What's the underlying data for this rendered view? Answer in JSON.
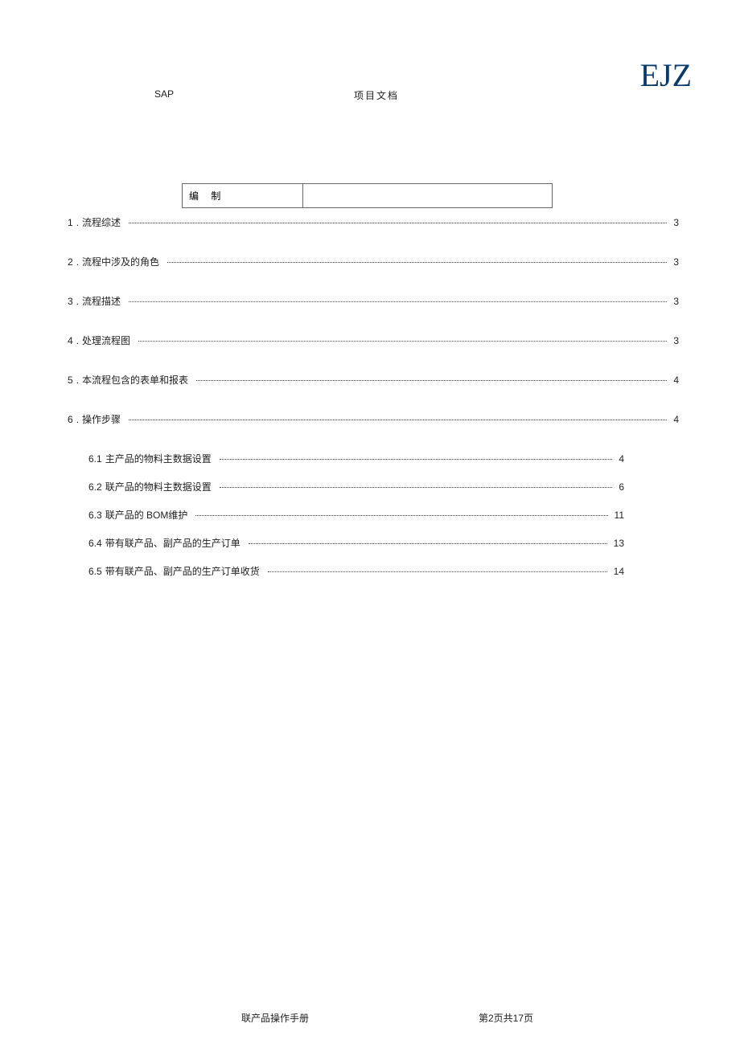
{
  "header": {
    "sap": "SAP",
    "doc": "项目文档",
    "logo": "EJZ"
  },
  "editbox": {
    "label": "编 制",
    "value": ""
  },
  "toc": [
    {
      "num": "1",
      "label": "流程综述",
      "page": "3",
      "level": 1
    },
    {
      "num": "2",
      "label": "流程中涉及的角色",
      "page": "3",
      "level": 1
    },
    {
      "num": "3",
      "label": "流程描述",
      "page": "3",
      "level": 1
    },
    {
      "num": "4",
      "label": "处理流程图",
      "page": "3",
      "level": 1
    },
    {
      "num": "5",
      "label": "本流程包含的表单和报表",
      "page": "4",
      "level": 1
    },
    {
      "num": "6",
      "label": "操作步骤",
      "page": "4",
      "level": 1
    },
    {
      "num": "6.1",
      "label": "主产品的物料主数据设置",
      "page": "4",
      "level": 2
    },
    {
      "num": "6.2",
      "label": "联产品的物料主数据设置",
      "page": "6",
      "level": 2
    },
    {
      "num": "6.3",
      "label": "联产品的  BOM维护",
      "page": "11",
      "level": 2
    },
    {
      "num": "6.4",
      "label": "带有联产品、副产品的生产订单",
      "page": "13",
      "level": 2
    },
    {
      "num": "6.5",
      "label": "带有联产品、副产品的生产订单收货",
      "page": "14",
      "level": 2
    }
  ],
  "footer": {
    "left": "联产品操作手册",
    "right": "第2页共17页"
  }
}
